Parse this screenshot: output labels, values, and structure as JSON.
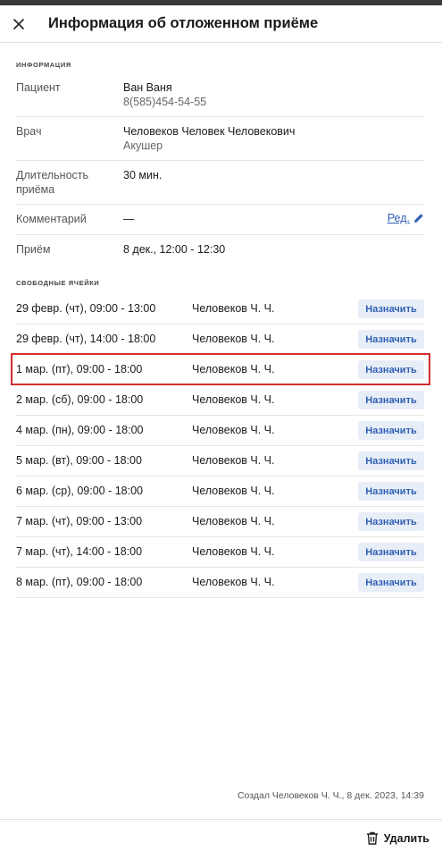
{
  "header": {
    "title": "Информация об отложенном приёме"
  },
  "info_section": {
    "label": "ИНФОРМАЦИЯ",
    "patient_label": "Пациент",
    "patient_name": "Ван Ваня",
    "patient_phone": "8(585)454-54-55",
    "doctor_label": "Врач",
    "doctor_name": "Человеков Человек Человекович",
    "doctor_specialty": "Акушер",
    "duration_label": "Длительность приёма",
    "duration_value": "30 мин.",
    "comment_label": "Комментарий",
    "comment_value": "—",
    "edit_label": "Ред.",
    "appointment_label": "Приём",
    "appointment_value": "8 дек., 12:00 - 12:30"
  },
  "slots_section": {
    "label": "СВОБОДНЫЕ ЯЧЕЙКИ",
    "assign_label": "Назначить",
    "slots": [
      {
        "date": "29 февр. (чт), 09:00 - 13:00",
        "doctor": "Человеков Ч. Ч."
      },
      {
        "date": "29 февр. (чт), 14:00 - 18:00",
        "doctor": "Человеков Ч. Ч."
      },
      {
        "date": "1 мар. (пт), 09:00 - 18:00",
        "doctor": "Человеков Ч. Ч."
      },
      {
        "date": "2 мар. (сб), 09:00 - 18:00",
        "doctor": "Человеков Ч. Ч."
      },
      {
        "date": "4 мар. (пн), 09:00 - 18:00",
        "doctor": "Человеков Ч. Ч."
      },
      {
        "date": "5 мар. (вт), 09:00 - 18:00",
        "doctor": "Человеков Ч. Ч."
      },
      {
        "date": "6 мар. (ср), 09:00 - 18:00",
        "doctor": "Человеков Ч. Ч."
      },
      {
        "date": "7 мар. (чт), 09:00 - 13:00",
        "doctor": "Человеков Ч. Ч."
      },
      {
        "date": "7 мар. (чт), 14:00 - 18:00",
        "doctor": "Человеков Ч. Ч."
      },
      {
        "date": "8 мар. (пт), 09:00 - 18:00",
        "doctor": "Человеков Ч. Ч."
      }
    ]
  },
  "footer": {
    "created_text": "Создал Человеков Ч. Ч., 8 дек. 2023, 14:39",
    "delete_label": "Удалить"
  },
  "colors": {
    "accent": "#2f5fb3",
    "button_bg": "#e8eef8",
    "highlight": "#d22c2c"
  }
}
